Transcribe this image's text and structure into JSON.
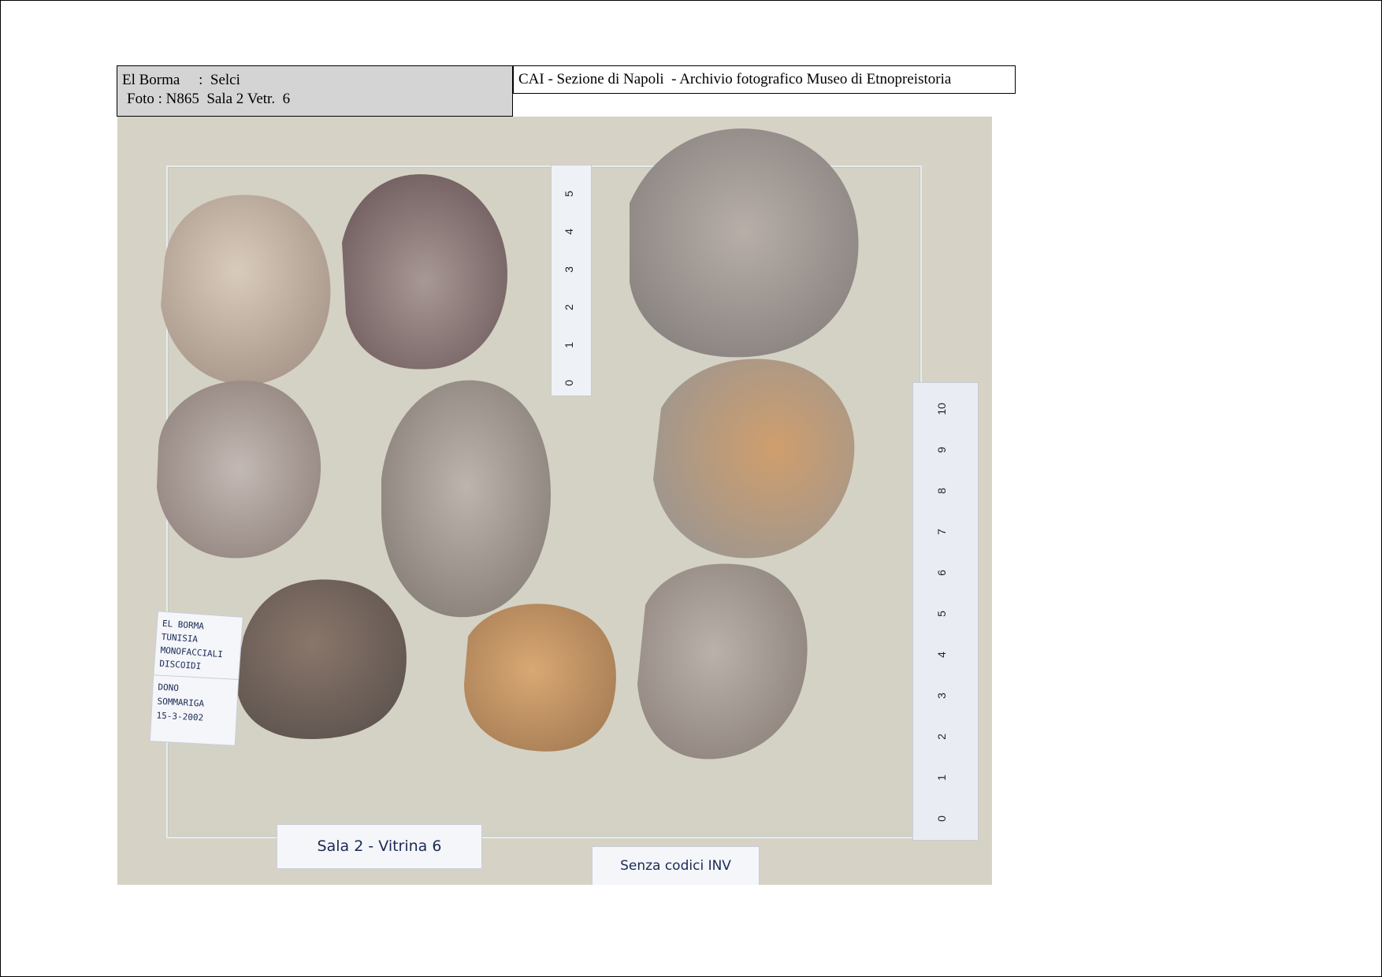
{
  "header": {
    "site_title": "El Borma     :  Selci",
    "photo_info": "Foto : N865  Sala 2 Vetr.  6",
    "archive": "CAI - Sezione di Napoli  - Archivio fotografico Museo di Etnopreistoria"
  },
  "photo": {
    "small_ruler_ticks": [
      "0",
      "1",
      "2",
      "3",
      "4",
      "5"
    ],
    "large_ruler_ticks": [
      "0",
      "1",
      "2",
      "3",
      "4",
      "5",
      "6",
      "7",
      "8",
      "9",
      "10"
    ],
    "label_site_lines": [
      "EL BORMA",
      "TUNISIA",
      "MONOFACCIALI",
      "DISCOIDI"
    ],
    "label_donor_lines": [
      "DONO",
      "SOMMARIGA",
      "15-3-2002"
    ],
    "label_room": "Sala 2 - Vitrina 6",
    "label_inventory": "Senza codici INV",
    "stone_colors": {
      "tan": "#c7b8a6",
      "grey": "#a79f99",
      "ochre": "#c8a06e",
      "brown": "#8a776a",
      "purple": "#8d7978"
    }
  }
}
